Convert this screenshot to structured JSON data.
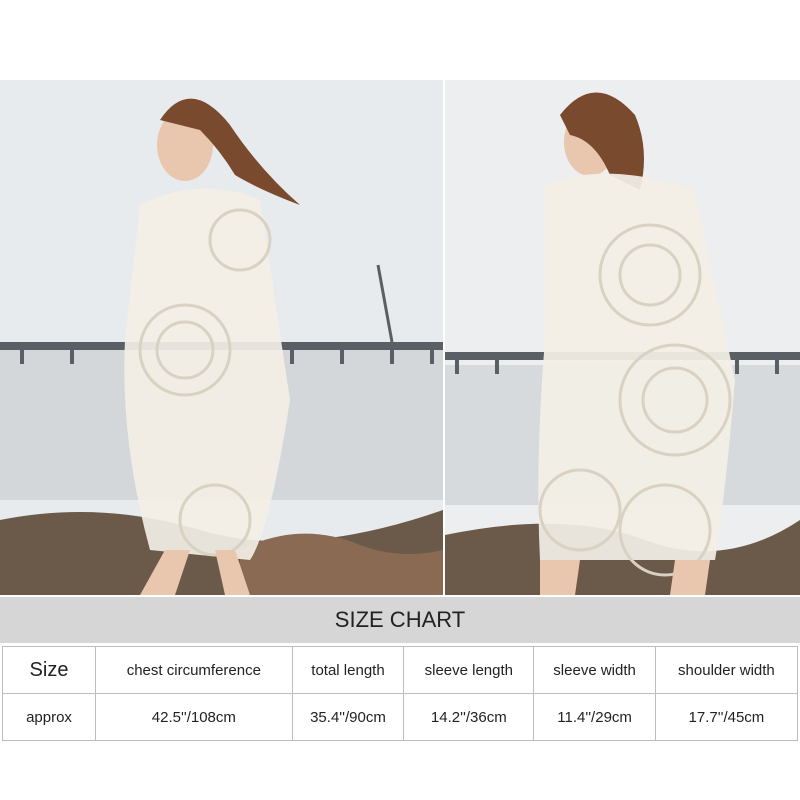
{
  "photos": [
    {
      "alt": "model wearing white lace kimono cover-up, side view"
    },
    {
      "alt": "model wearing white lace kimono cover-up, back view"
    }
  ],
  "size_chart": {
    "title": "SIZE CHART",
    "header": [
      "Size",
      "chest circumference",
      "total length",
      "sleeve length",
      "sleeve width",
      "shoulder width"
    ],
    "rows": [
      [
        "approx",
        "42.5''/108cm",
        "35.4''/90cm",
        "14.2''/36cm",
        "11.4''/29cm",
        "17.7''/45cm"
      ]
    ]
  },
  "colors": {
    "header_bg": "#d6d6d6",
    "border": "#bdbdbd",
    "sky": "#e9ecee",
    "sea": "#d4d8da",
    "rocks": "#6b5a4a",
    "lace": "#f3efe6",
    "hair": "#7a4a2e"
  }
}
